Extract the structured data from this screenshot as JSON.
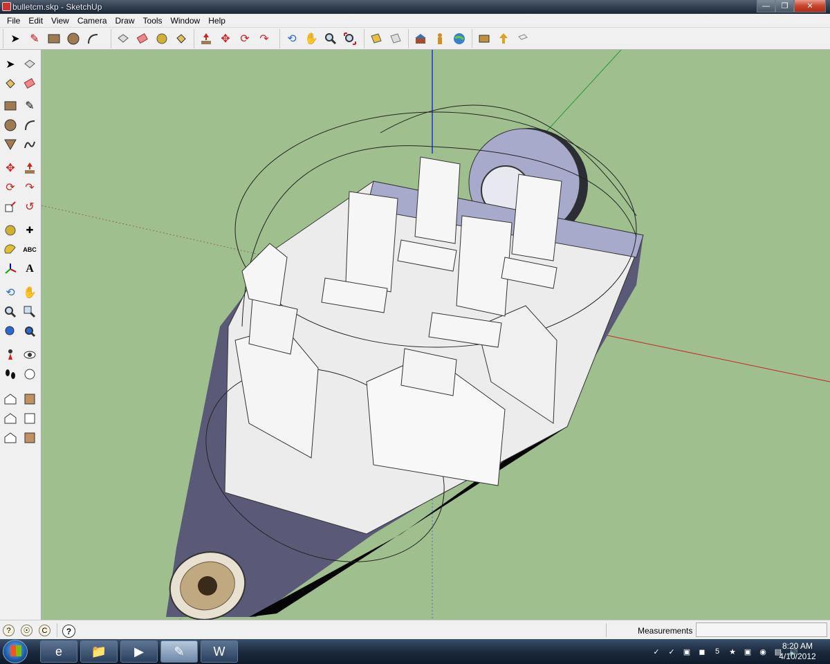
{
  "window": {
    "title": "bulletcm.skp - SketchUp"
  },
  "window_controls": [
    "minimize",
    "maximize",
    "close"
  ],
  "menu": [
    "File",
    "Edit",
    "View",
    "Camera",
    "Draw",
    "Tools",
    "Window",
    "Help"
  ],
  "top_toolbar": [
    "select",
    "pencil",
    "rectangle",
    "circle",
    "arc",
    "make-component",
    "eraser",
    "tape-measure",
    "paint-bucket",
    "push-pull",
    "move",
    "rotate",
    "follow-me",
    "orbit",
    "pan",
    "zoom",
    "zoom-extents",
    "section-plane",
    "section-display",
    "warehouse",
    "figure",
    "google-earth",
    "components",
    "share",
    "3d-text"
  ],
  "left_toolbar": [
    "select",
    "make-component",
    "paint-bucket",
    "eraser",
    "rectangle",
    "line",
    "circle",
    "arc",
    "polygon",
    "freehand",
    "move",
    "push-pull",
    "rotate",
    "follow-me",
    "scale",
    "offset",
    "tape-measure",
    "dimension",
    "protractor",
    "text",
    "axes",
    "3d-text",
    "orbit",
    "pan",
    "zoom",
    "zoom-window",
    "previous",
    "zoom-extents",
    "position-camera",
    "look-around",
    "walk",
    "section-plane",
    "iso-view",
    "front-view",
    "top-view",
    "left-view",
    "right-view",
    "back-view"
  ],
  "status": {
    "measurements_label": "Measurements",
    "measurements_value": ""
  },
  "taskbar": {
    "time": "8:20 AM",
    "date": "4/10/2012"
  },
  "colors": {
    "viewport": "#9fbf8f",
    "titlebar": "#2c3a4b",
    "hull": "#5a5a78",
    "interior": "#ebebeb"
  }
}
